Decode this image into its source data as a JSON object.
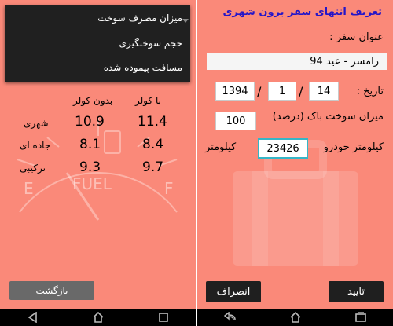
{
  "left": {
    "menu": {
      "items": [
        "میزان مصرف سوخت",
        "حجم سوختگیری",
        "مسافت پیموده شده"
      ]
    },
    "table": {
      "headers": [
        "با کولر",
        "بدون کولر"
      ],
      "rows": [
        {
          "label": "شهری",
          "with_ac": "11.4",
          "without_ac": "10.9"
        },
        {
          "label": "جاده ای",
          "with_ac": "8.4",
          "without_ac": "8.1"
        },
        {
          "label": "ترکیبی",
          "with_ac": "9.7",
          "without_ac": "9.3"
        }
      ]
    },
    "gauge": {
      "e_label": "E",
      "fuel_label": "FUEL",
      "f_label": "F"
    },
    "back_label": "بازگشت"
  },
  "right": {
    "title": "تعریف انتهای سفر برون شهری",
    "trip_title_label": "عنوان سفر :",
    "trip_title_value": "رامسر - عید 94",
    "date_label": "تاریخ :",
    "date": {
      "day": "14",
      "month": "1",
      "year": "1394"
    },
    "fuel_label": "میزان سوخت باک (درصد)",
    "fuel_value": "100",
    "odometer_label": "کیلومتر خودرو",
    "odometer_value": "23426",
    "km_label": "کیلومتر",
    "confirm_label": "تایید",
    "cancel_label": "انصراف"
  },
  "colors": {
    "screen_bg": "#fa8979",
    "title": "#2416c8",
    "dark": "#1f1f1f",
    "menu": "#202020"
  },
  "icons": [
    "back-triangle-icon",
    "home-icon",
    "recents-icon"
  ]
}
